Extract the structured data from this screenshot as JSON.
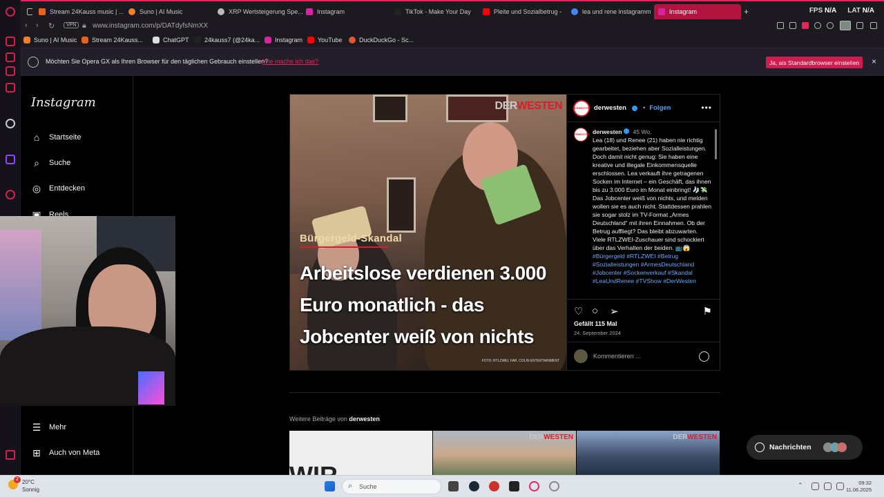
{
  "tabs": [
    {
      "title": "Stream 24Kauss music | ...",
      "color": "#e8621c"
    },
    {
      "title": "Suno | AI Music",
      "color": "#f08030"
    },
    {
      "title": "XRP Wertsteigerung Spe...",
      "color": "#bbbbbb"
    },
    {
      "title": "Instagram",
      "color": "#d6249f"
    },
    {
      "title": "TikTok - Make Your Day",
      "color": "#222222"
    },
    {
      "title": "Pleite und Sozialbetrug -",
      "color": "#ff0000"
    },
    {
      "title": "lea und rene instagramm",
      "color": "#4285f4"
    },
    {
      "title": "Instagram",
      "color": "#d6249f",
      "active": true
    }
  ],
  "perf": {
    "fps_label": "FPS",
    "fps_value": "N/A",
    "lat_label": "LAT",
    "lat_value": "N/A"
  },
  "address": {
    "vpn": "VPN",
    "url": "www.instagram.com/p/DATdyfsNmXX"
  },
  "bookmarks": [
    {
      "label": "Suno | AI Music",
      "color": "#f08030"
    },
    {
      "label": "Stream 24Kauss...",
      "color": "#e8621c"
    },
    {
      "label": "ChatGPT",
      "color": "#dddddd"
    },
    {
      "label": "24kauss7 (@24ka...",
      "color": "#222222"
    },
    {
      "label": "Instagram",
      "color": "#d6249f"
    },
    {
      "label": "YouTube",
      "color": "#ff0000"
    },
    {
      "label": "DuckDuckGo - Sc...",
      "color": "#de5833"
    }
  ],
  "infobar": {
    "text": "Möchten Sie Opera GX als Ihren Browser für den täglichen Gebrauch einstellen?",
    "link": "Wie mache ich das?",
    "button": "Ja, als Standardbrowser einstellen",
    "close": "×"
  },
  "instagram": {
    "logo": "Instagram",
    "nav": [
      {
        "label": "Startseite",
        "icon": "home-icon",
        "glyph": "⌂"
      },
      {
        "label": "Suche",
        "icon": "search-icon",
        "glyph": "⌕"
      },
      {
        "label": "Entdecken",
        "icon": "compass-icon",
        "glyph": "◎"
      },
      {
        "label": "Reels",
        "icon": "reels-icon",
        "glyph": "▣"
      }
    ],
    "nav_bottom": [
      {
        "label": "Mehr",
        "icon": "menu-icon",
        "glyph": "☰"
      },
      {
        "label": "Auch von Meta",
        "icon": "meta-icon",
        "glyph": "⊞"
      }
    ]
  },
  "post": {
    "brand_a": "DER",
    "brand_b": "WESTEN",
    "kicker": "Bürgergeld-Skandal",
    "headline": "Arbeitslose verdienen 3.000 Euro monatlich - das Jobcenter weiß von nichts",
    "credit": "FOTO: RTLZWEI, FAR, COLIN ENTERTAINMENT",
    "username": "derwesten",
    "follow": "Folgen",
    "more": "•••",
    "avatar_text": "DERWESTEN",
    "caption_user": "derwesten",
    "caption_time": "45 Wo.",
    "caption": "Lea (18) und Renee (21) haben nie richtig gearbeitet, beziehen aber Sozialleistungen. Doch damit nicht genug: Sie haben eine kreative und illegale Einkommensquelle erschlossen. Lea verkauft ihre getragenen Socken im Internet – ein Geschäft, das ihnen bis zu 3.000 Euro im Monat einbringt! 🧦💸 Das Jobcenter weiß von nichts, und melden wollen sie es auch nicht. Stattdessen prahlen sie sogar stolz im TV-Format „Armes Deutschland“ mit ihren Einnahmen. Ob der Betrug auffliegt? Das bleibt abzuwarten. Viele RTLZWEI-Zuschauer sind schockiert über das Verhalten der beiden. 📺😱",
    "hashtags": "#Bürgergeld #RTLZWEI #Betrug #Sozialleistungen #ArmesDeutschland #Jobcenter #Sockenverkauf #Skandal #LeaUndRenee #TVShow #DerWesten",
    "likes": "Gefällt 115 Mal",
    "date": "24. September 2024",
    "comment_placeholder": "Kommentieren ..."
  },
  "more_posts": {
    "label": "Weitere Beiträge von",
    "user": "derwesten",
    "thumb_brand_a": "DER",
    "thumb_brand_b": "WESTEN",
    "thumb_text": "WIR"
  },
  "messages": {
    "label": "Nachrichten"
  },
  "taskbar": {
    "temp": "20°C",
    "weather": "Sonnig",
    "weather_badge": "2",
    "search": "Suche",
    "time": "09:32",
    "date": "11.06.2025"
  }
}
